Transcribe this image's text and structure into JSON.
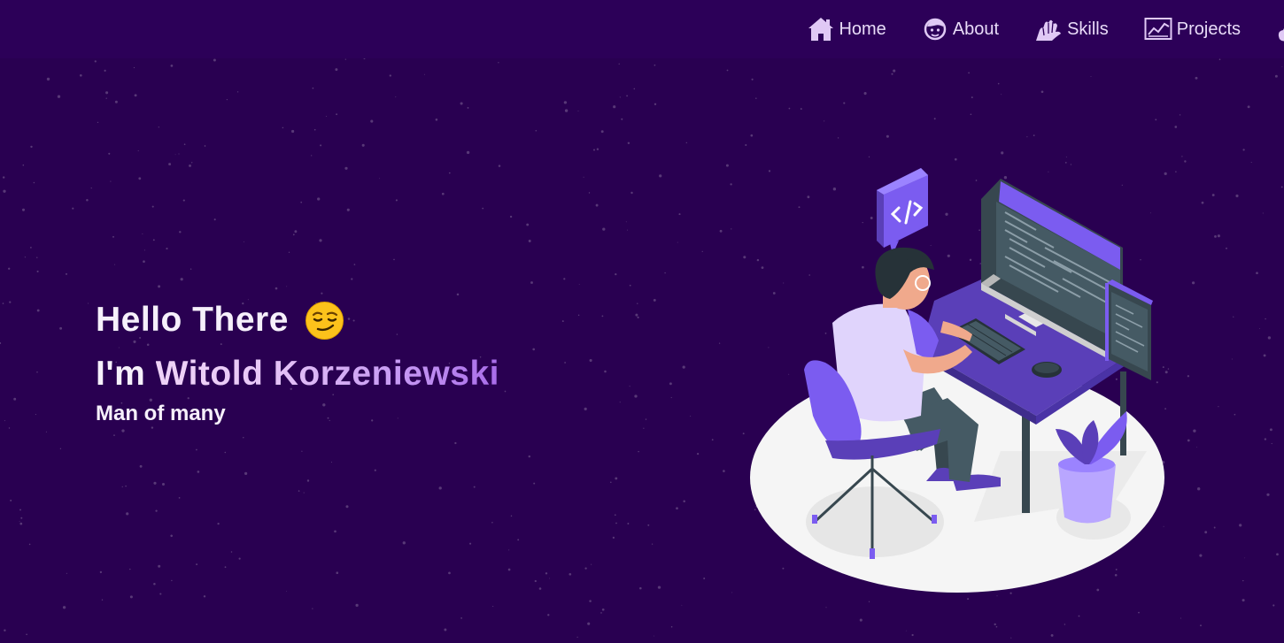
{
  "nav": {
    "items": [
      {
        "label": "Home",
        "icon": "home-icon"
      },
      {
        "label": "About",
        "icon": "user-icon"
      },
      {
        "label": "Skills",
        "icon": "hand-icon"
      },
      {
        "label": "Projects",
        "icon": "chart-icon"
      }
    ],
    "extra_icon": "guitar-icon"
  },
  "hero": {
    "greeting": "Hello There",
    "greeting_emoji": "smirk-emoji",
    "intro_prefix": "I'm ",
    "name": "Witold Korzeniewski",
    "tagline": "Man of many"
  },
  "colors": {
    "background": "#290051",
    "accent": "#7b5cf0",
    "text": "#f6f0fb"
  }
}
